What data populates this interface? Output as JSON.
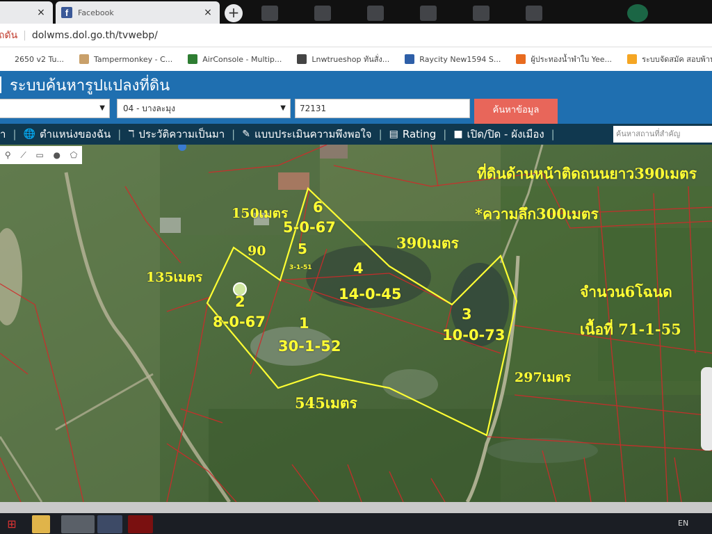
{
  "browser": {
    "tabs": [
      {
        "title": "",
        "close": "×"
      },
      {
        "title": "Facebook",
        "close": "×",
        "icon": "facebook-icon"
      }
    ],
    "new_tab": "+",
    "address": {
      "secure_label": "ถดัน",
      "url": "dolwms.dol.go.th/tvwebp/"
    },
    "bookmarks": [
      {
        "label": "2650 v2 Tu...",
        "color": "#ffffff"
      },
      {
        "label": "Tampermonkey - C...",
        "color": "#c9a06a"
      },
      {
        "label": "AirConsole - Multip...",
        "color": "#2e7d32"
      },
      {
        "label": "Lnwtrueshop ทันสั่ง...",
        "color": "#444444"
      },
      {
        "label": "Raycity New1594 S...",
        "color": "#2e5fa8"
      },
      {
        "label": "ผู้ประทองน้ำพำใบ Yee...",
        "color": "#e86b1f"
      },
      {
        "label": "ระบบจัดสมัค สอบพ้าน...",
        "color": "#f5a623"
      }
    ]
  },
  "app": {
    "title": "ระบบค้นหารูปแปลงที่ดิน",
    "search": {
      "province_value": "",
      "district_value": "04 - บางละมุง",
      "parcel_value": "72131",
      "button": "ค้นหาข้อมูล"
    },
    "menu": [
      {
        "label": "ำ",
        "icon": ""
      },
      {
        "label": "ตำแหน่งของฉัน",
        "icon": "globe-icon"
      },
      {
        "label": "ประวัติความเป็นมา",
        "icon": "history-icon"
      },
      {
        "label": "แบบประเมินความพึงพอใจ",
        "icon": "edit-icon"
      },
      {
        "label": "Rating",
        "icon": "chart-icon"
      },
      {
        "label": "เปิด/ปิด - ผังเมือง",
        "icon": "square-icon"
      }
    ],
    "menu_search_placeholder": "ค้นหาสถานที่สำคัญ"
  },
  "map": {
    "tools": [
      "pin-tool",
      "line-tool",
      "rect-tool",
      "circle-tool",
      "polygon-tool"
    ],
    "labels": {
      "road_front": "ที่ดินด้านหน้าติดถนนยาว390เมตร",
      "depth": "*ความลึก300เมตร",
      "count": "จำนวน6โฉนด",
      "area_total": "เนื้อที่ 71-1-55",
      "len_150": "150เมตร",
      "len_90": "90",
      "len_135": "135เมตร",
      "len_390": "390เมตร",
      "len_297": "297เมตร",
      "len_545": "545เมตร"
    },
    "plots": [
      {
        "no": "1",
        "area": "30-1-52"
      },
      {
        "no": "2",
        "area": "8-0-67"
      },
      {
        "no": "3",
        "area": "10-0-73"
      },
      {
        "no": "4",
        "area": "14-0-45"
      },
      {
        "no": "5",
        "area": "3-1-51"
      },
      {
        "no": "6",
        "area": "5-0-67"
      }
    ],
    "colors": {
      "boundary": "#ffff33",
      "parcel_lines": "#d02a2a"
    }
  },
  "taskbar": {
    "lang": "EN"
  }
}
